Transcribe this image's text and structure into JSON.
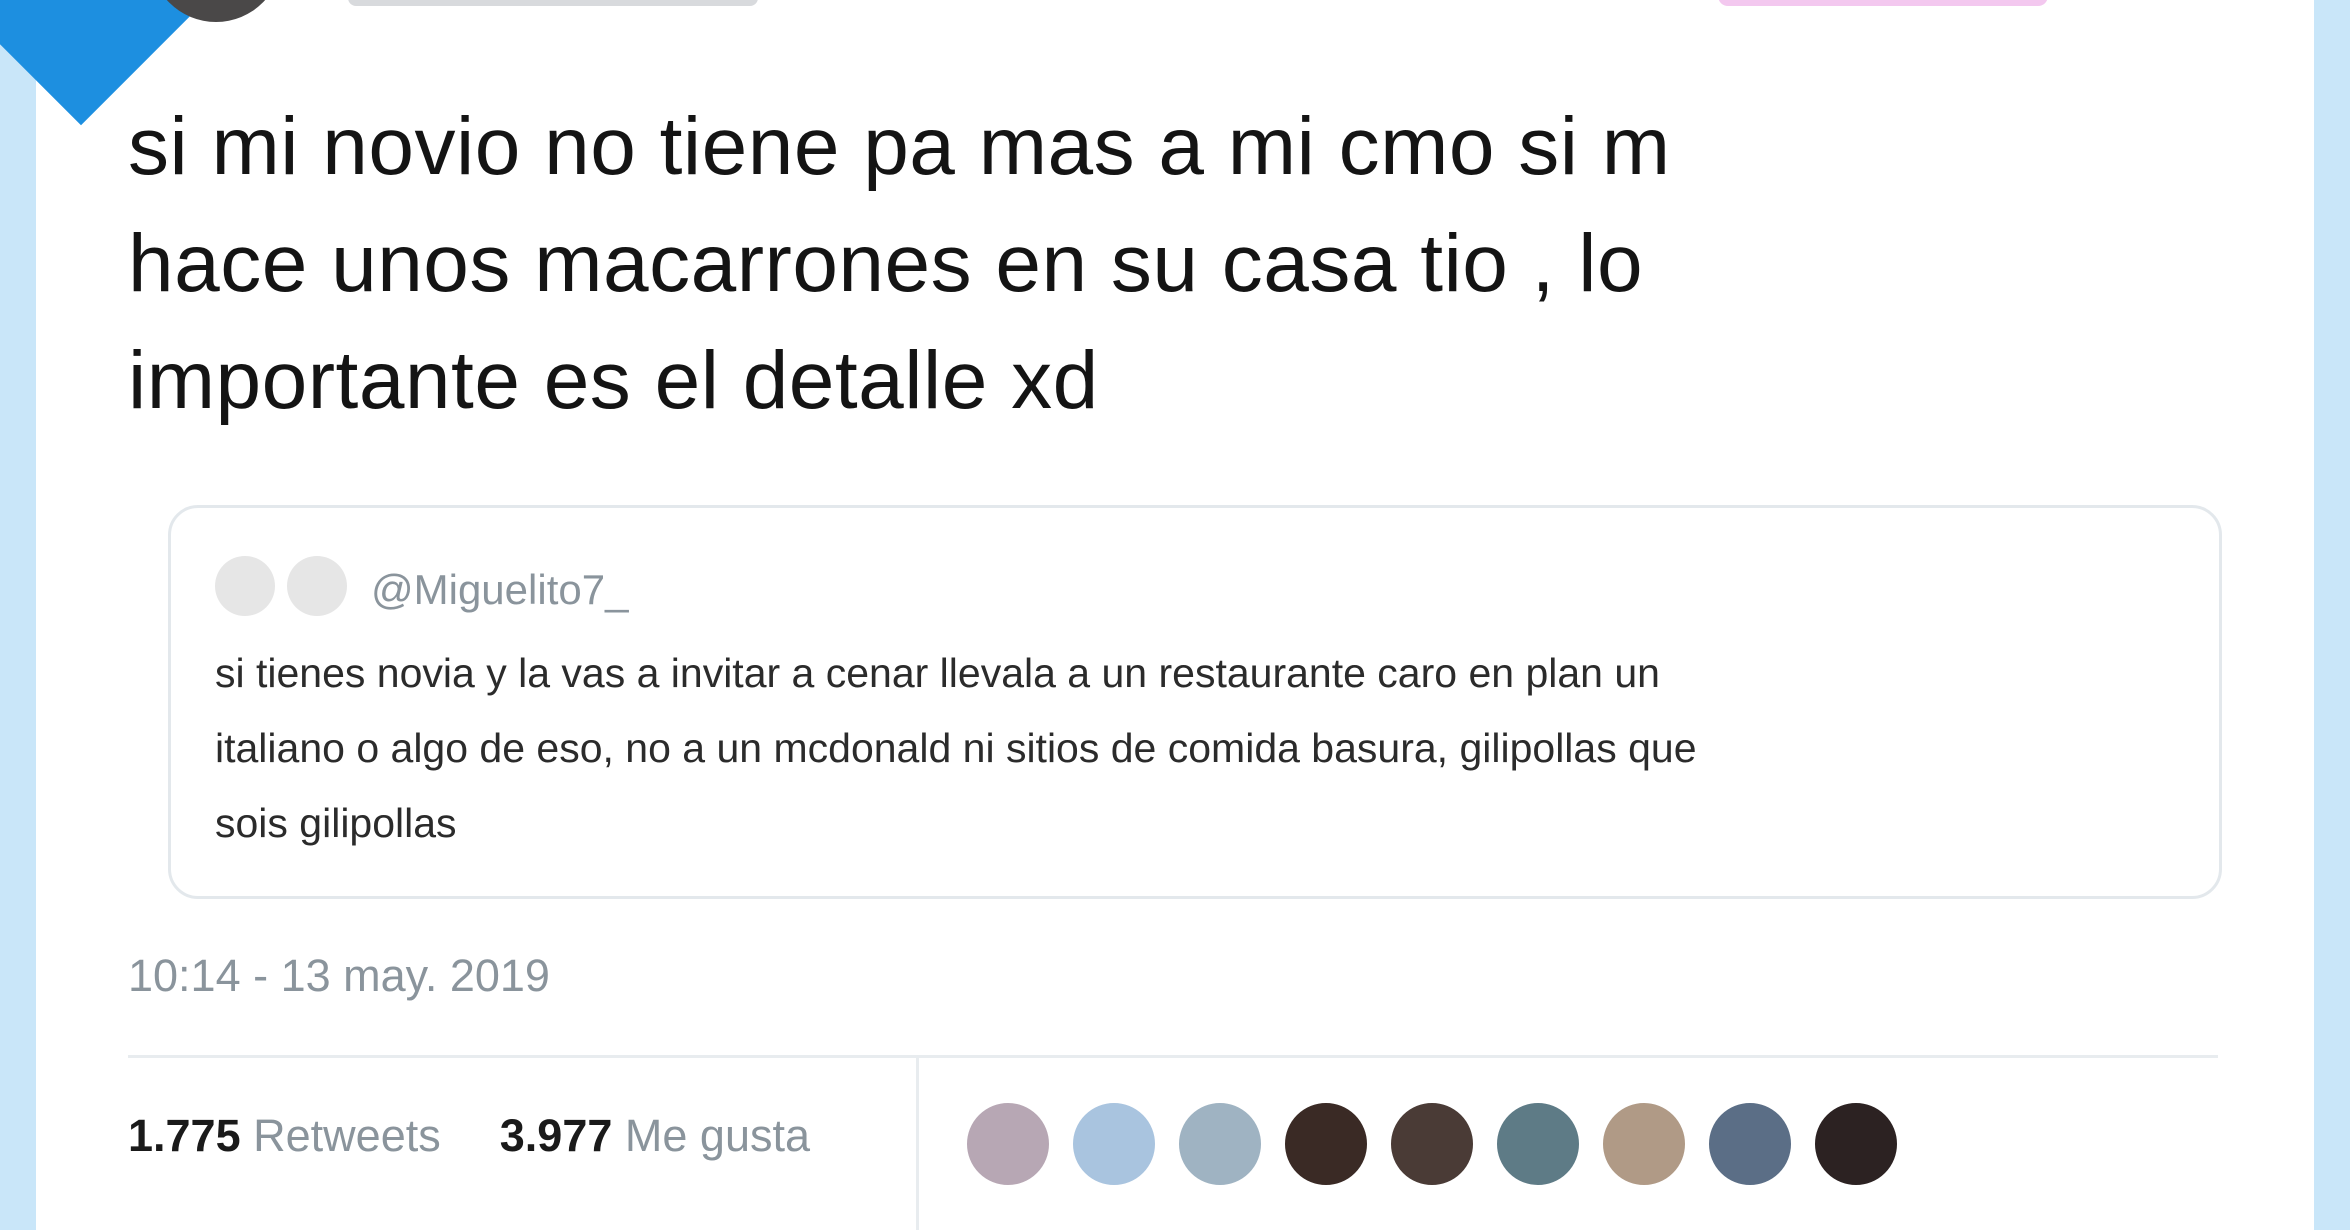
{
  "tweet": {
    "text": "si mi novio no tiene pa mas a mi cmo si m\nhace unos macarrones en su casa tio , lo\nimportante es el detalle xd",
    "timestamp": "10:14 - 13 may. 2019"
  },
  "quoted_tweet": {
    "handle": "@Miguelito7_",
    "text": "si tienes novia y la vas a invitar a cenar llevala a un restaurante caro en plan un\nitaliano o algo de eso, no a un mcdonald ni sitios de comida basura, gilipollas que\nsois gilipollas"
  },
  "stats": {
    "retweets_count": "1.775",
    "retweets_label": "Retweets",
    "likes_count": "3.977",
    "likes_label": "Me gusta"
  },
  "likers": [
    {
      "color": "#b7a7b4"
    },
    {
      "color": "#a9c4df"
    },
    {
      "color": "#9fb3c2"
    },
    {
      "color": "#3a2a25"
    },
    {
      "color": "#4a3b36"
    },
    {
      "color": "#5e7b86"
    },
    {
      "color": "#b09a86"
    },
    {
      "color": "#5b6e86"
    },
    {
      "color": "#2c2222"
    }
  ]
}
